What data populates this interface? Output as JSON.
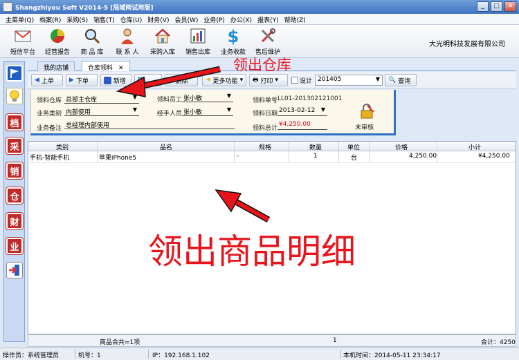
{
  "window": {
    "title": "Shangzhiyou Soft V2014-5 [局域网试用版]"
  },
  "menu": [
    "主菜单(Q)",
    "档案(R)",
    "采购(S)",
    "销售(T)",
    "仓库(U)",
    "财务(V)",
    "会员(W)",
    "业务(P)",
    "办公(X)",
    "报表(Y)",
    "帮助(Z)"
  ],
  "toolbar": [
    "短信平台",
    "经营报告",
    "商 品 库",
    "联 系 人",
    "采购入库",
    "销售出库",
    "业务收款",
    "售后维护"
  ],
  "company": "大光明科技发展有限公司",
  "sidebar": [
    "档",
    "采",
    "销",
    "仓",
    "财",
    "业"
  ],
  "tabs": [
    "我的店铺",
    "仓库领料"
  ],
  "actions": {
    "prev": "上单",
    "next": "下单",
    "new": "新增",
    "delete": "删除",
    "more": "更多功能",
    "print": "打印",
    "design": "设计",
    "period": "201405",
    "query": "查询"
  },
  "form": {
    "warehouse_label": "领料仓库",
    "warehouse": "总部主仓库",
    "biztype_label": "业务类别",
    "biztype": "内部使用",
    "remark_label": "业务备注",
    "remark": "总经理内部使用",
    "employee_label": "领料员工",
    "employee": "张小敏",
    "handler_label": "经手人员",
    "handler": "张小敏",
    "docno_label": "领料单号",
    "docno": "LL01-201302121001",
    "date_label": "领料日期",
    "date": "2013-02-12",
    "total_label": "领料总计",
    "total": "¥4,250.00",
    "audit_status": "未审核"
  },
  "table": {
    "columns": [
      "类别",
      "品名",
      "规格",
      "数量",
      "单位",
      "价格",
      "小计"
    ],
    "rows": [
      [
        "手机-智能手机",
        "苹果iPhone5",
        "-",
        "1",
        "台",
        "4,250.00",
        "¥4,250.00"
      ]
    ],
    "footer": {
      "count": "商品合共=1项",
      "qty": "1",
      "total": "合计：4250"
    }
  },
  "status": {
    "operator": "操作员：系统管理员",
    "machine": "机号：1",
    "ip": "IP：192.168.1.102",
    "time": "本机时间：2014-05-11 23:34:17"
  },
  "annotations": {
    "arrow_text": "领出仓库",
    "detail_text": "领出商品明细"
  },
  "colors": {
    "annotation": "#e8141c",
    "form_border": "#2f6fc4",
    "title_bar": "#3f73c4"
  }
}
